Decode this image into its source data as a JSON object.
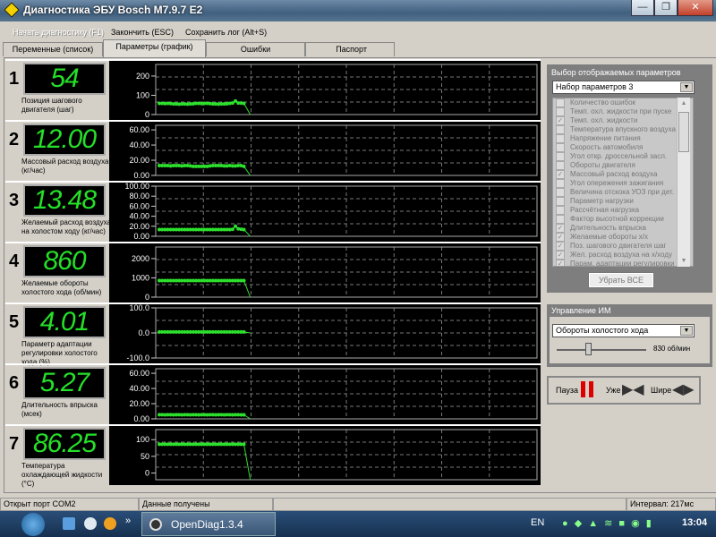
{
  "window": {
    "title": "Диагностика ЭБУ Bosch M7.9.7 E2",
    "minimize": "—",
    "maximize": "❐",
    "close": "✕"
  },
  "menu": {
    "start": "Начать диагностику (F1)",
    "stop": "Закончить (ESC)",
    "save": "Сохранить лог (Alt+S)"
  },
  "tabs": [
    {
      "label": "Переменные (список)"
    },
    {
      "label": "Параметры (график)",
      "active": true
    },
    {
      "label": "Ошибки"
    },
    {
      "label": "Паспорт"
    }
  ],
  "panels": [
    {
      "num": "1",
      "value": "54",
      "label": "Позиция шагового двигателя (шаг)",
      "ticks": [
        "200",
        "100",
        "0"
      ],
      "ylim": [
        0,
        260
      ],
      "tickvals": [
        200,
        100,
        0
      ]
    },
    {
      "num": "2",
      "value": "12.00",
      "label": "Массовый расход воздуха (кг/час)",
      "ticks": [
        "60.00",
        "40.00",
        "20.00",
        "0.00"
      ],
      "ylim": [
        0,
        66
      ],
      "tickvals": [
        60,
        40,
        20,
        0
      ]
    },
    {
      "num": "3",
      "value": "13.48",
      "label": "Желаемый расход воздуха на холостом ходу (кг/час)",
      "ticks": [
        "100.00",
        "80.00",
        "60.00",
        "40.00",
        "20.00",
        "0.00"
      ],
      "ylim": [
        0,
        100
      ],
      "tickvals": [
        100,
        80,
        60,
        40,
        20,
        0
      ]
    },
    {
      "num": "4",
      "value": "860",
      "label": "Желаемые обороты холостого хода (об/мин)",
      "ticks": [
        "2000",
        "1000",
        "0"
      ],
      "ylim": [
        0,
        2600
      ],
      "tickvals": [
        2000,
        1000,
        0
      ]
    },
    {
      "num": "5",
      "value": "4.01",
      "label": "Параметр адаптации регулировки холостого хода (%)",
      "ticks": [
        "100.0",
        "0.0",
        "-100.0"
      ],
      "ylim": [
        -100,
        100
      ],
      "tickvals": [
        100,
        0,
        -100
      ]
    },
    {
      "num": "6",
      "value": "5.27",
      "label": "Длительность впрыска (мсек)",
      "ticks": [
        "60.00",
        "40.00",
        "20.00",
        "0.00"
      ],
      "ylim": [
        0,
        66
      ],
      "tickvals": [
        60,
        40,
        20,
        0
      ]
    },
    {
      "num": "7",
      "value": "86.25",
      "label": "Температура охлаждающей жидкости (°C)",
      "ticks": [
        "100",
        "50",
        "0"
      ],
      "ylim": [
        -20,
        130
      ],
      "tickvals": [
        100,
        50,
        0
      ]
    }
  ],
  "chart_data": [
    {
      "type": "line",
      "title": "Позиция шагового двигателя (шаг)",
      "values": [
        58,
        58,
        57,
        58,
        57,
        55,
        55,
        54,
        55,
        55,
        54,
        55,
        56,
        58,
        58,
        57,
        58,
        58,
        57,
        55,
        55,
        54,
        55,
        55,
        56,
        58,
        60,
        70,
        60,
        60,
        58,
        0
      ]
    },
    {
      "type": "line",
      "title": "Массовый расход воздуха (кг/час)",
      "values": [
        13,
        13,
        13,
        13,
        12.5,
        13,
        13,
        13,
        12.5,
        13,
        13,
        12.5,
        12,
        12,
        12,
        12,
        12,
        12,
        12.5,
        13,
        13,
        13,
        13,
        12.5,
        12.5,
        13,
        12.5,
        12.5,
        13,
        13,
        12,
        0
      ]
    },
    {
      "type": "line",
      "title": "Желаемый расход воздуха на холостом ходу (кг/час)",
      "values": [
        13.5,
        13.5,
        13.5,
        13.5,
        13.5,
        13.5,
        13.5,
        13.5,
        13.5,
        13.5,
        13.5,
        13.5,
        13.5,
        13.5,
        13.5,
        13.5,
        13.5,
        13.5,
        13.5,
        13.5,
        13.5,
        13.5,
        13.5,
        13.5,
        13.5,
        13.5,
        14,
        20,
        15,
        14,
        13.5,
        0
      ]
    },
    {
      "type": "line",
      "title": "Желаемые обороты холостого хода (об/мин)",
      "values": [
        860,
        860,
        860,
        860,
        860,
        860,
        860,
        860,
        860,
        860,
        860,
        860,
        860,
        860,
        860,
        860,
        860,
        860,
        860,
        860,
        860,
        860,
        860,
        860,
        860,
        860,
        860,
        860,
        860,
        860,
        860,
        0
      ]
    },
    {
      "type": "line",
      "title": "Параметр адаптации регулировки холостого хода (%)",
      "values": [
        4,
        4,
        4,
        4,
        4,
        4,
        4,
        4,
        4,
        4,
        4,
        4,
        4,
        4,
        4,
        4,
        4,
        4,
        4,
        4,
        4,
        4,
        4,
        4,
        4,
        4,
        4,
        4,
        4,
        4,
        4,
        0
      ]
    },
    {
      "type": "line",
      "title": "Длительность впрыска (мсек)",
      "values": [
        5.5,
        5.5,
        5.3,
        5.5,
        5.5,
        5.3,
        5.5,
        5.5,
        5.3,
        5.5,
        5.5,
        5.3,
        5.5,
        5.5,
        5.3,
        5.5,
        5.5,
        5.3,
        5.5,
        5.5,
        5.3,
        5.5,
        5.5,
        5.3,
        5.5,
        5.5,
        5.3,
        5.5,
        5.5,
        5.3,
        5.3,
        0
      ]
    },
    {
      "type": "line",
      "title": "Температура охлаждающей жидкости (°C)",
      "values": [
        86,
        86,
        86,
        86,
        86,
        86,
        86,
        86,
        86,
        86,
        86,
        86,
        86,
        86,
        86,
        86,
        86,
        86,
        86,
        86,
        86,
        86,
        86,
        86,
        86,
        86,
        86,
        86,
        86,
        86,
        86,
        -20
      ]
    }
  ],
  "selector": {
    "title": "Выбор отображаемых параметров",
    "set": "Набор параметров 3",
    "remove_all": "Убрать ВСЕ",
    "items": [
      {
        "label": "Количество ошибок",
        "checked": false
      },
      {
        "label": "Темп. охл. жидкости при пуске",
        "checked": false
      },
      {
        "label": "Темп. охл. жидкости",
        "checked": true
      },
      {
        "label": "Температура впускного воздуха",
        "checked": false
      },
      {
        "label": "Напряжение питания",
        "checked": false
      },
      {
        "label": "Скорость автомобиля",
        "checked": false
      },
      {
        "label": "Угол откр. дроссельной засл.",
        "checked": false
      },
      {
        "label": "Обороты двигателя",
        "checked": false
      },
      {
        "label": "Массовый расход воздуха",
        "checked": true
      },
      {
        "label": "Угол опережения зажигания",
        "checked": false
      },
      {
        "label": "Величина отскока УОЗ при дет.",
        "checked": false
      },
      {
        "label": "Параметр нагрузки",
        "checked": false
      },
      {
        "label": "Рассчётная нагрузка",
        "checked": false
      },
      {
        "label": "Фактор высотной коррекции",
        "checked": false
      },
      {
        "label": "Длительность впрыска",
        "checked": true
      },
      {
        "label": "Желаемые обороты х/х",
        "checked": true
      },
      {
        "label": "Поз. шагового двигателя шаг",
        "checked": true
      },
      {
        "label": "Жел. расход воздуха на х/ходу",
        "checked": true
      },
      {
        "label": "Парам. адаптации регулировки",
        "checked": true
      }
    ]
  },
  "im": {
    "title": "Управление ИМ",
    "select": "Обороты холостого хода",
    "slider_value": "830 об/мин",
    "slider_fraction": 0.35
  },
  "controls": {
    "pause": "Пауза",
    "narrow": "Уже",
    "wide": "Шире"
  },
  "status": {
    "port": "Открыт порт COM2",
    "data": "Данные получены",
    "interval": "Интервал: 217мс"
  },
  "taskbar": {
    "app": "OpenDiag1.3.4",
    "lang": "EN",
    "time": "13:04"
  }
}
